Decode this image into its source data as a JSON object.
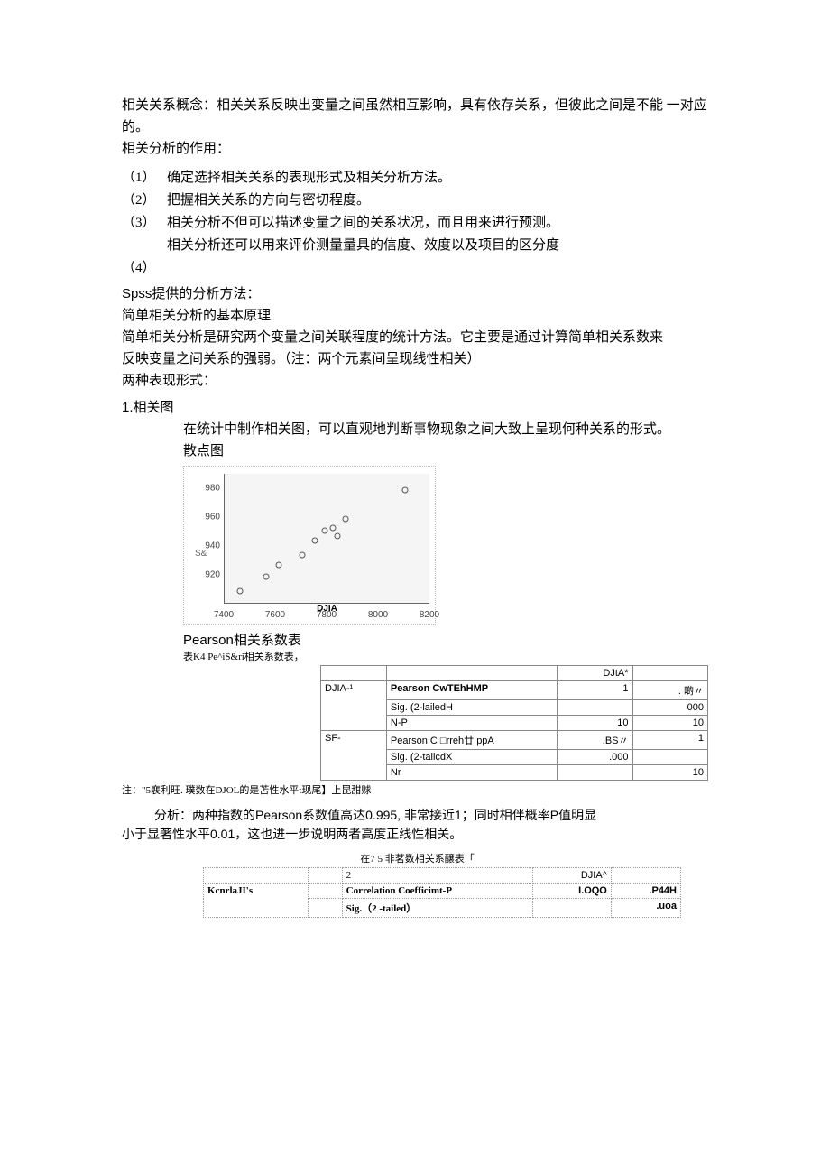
{
  "intro": {
    "line1": "相关关系概念：相关关系反映出变量之间虽然相互影响，具有依存关系，但彼此之间是不能 一对应的。",
    "line2": "相关分析的作用："
  },
  "list": {
    "items": [
      {
        "num": "（1）",
        "txt": "确定选择相关关系的表现形式及相关分析方法。"
      },
      {
        "num": "（2）",
        "txt": "把握相关关系的方向与密切程度。"
      },
      {
        "num": "（3）",
        "txt": "相关分析不但可以描述变量之间的关系状况，而且用来进行预测。"
      },
      {
        "num": "",
        "txt": "相关分析还可以用来评价测量量具的信度、效度以及项目的区分度"
      },
      {
        "num": "（4）",
        "txt": ""
      }
    ]
  },
  "body": {
    "spss": "Spss提供的分析方法：",
    "p1": "简单相关分析的基本原理",
    "p2": "简单相关分析是研究两个变量之间关联程度的统计方法。它主要是通过计算简单相关系数来",
    "p3": "反映变量之间关系的强弱。（注：两个元素间呈现线性相关）",
    "p4": "两种表现形式：",
    "h1": "1.相关图",
    "s1": "在统计中制作相关图，可以直观地判断事物现象之间大致上呈现何种关系的形式。",
    "s2": "散点图"
  },
  "chart_data": {
    "type": "scatter",
    "xlabel": "DJIA",
    "ylabel": "S&",
    "xlim": [
      7400,
      8200
    ],
    "ylim": [
      900,
      990
    ],
    "xticks": [
      7400,
      7600,
      7800,
      8000,
      8200
    ],
    "yticks": [
      920,
      940,
      960,
      980
    ],
    "points": [
      {
        "x": 7460,
        "y": 910
      },
      {
        "x": 7560,
        "y": 920
      },
      {
        "x": 7610,
        "y": 928
      },
      {
        "x": 7700,
        "y": 935
      },
      {
        "x": 7750,
        "y": 945
      },
      {
        "x": 7790,
        "y": 952
      },
      {
        "x": 7820,
        "y": 954
      },
      {
        "x": 7840,
        "y": 948
      },
      {
        "x": 7870,
        "y": 960
      },
      {
        "x": 8100,
        "y": 980
      }
    ]
  },
  "pearson": {
    "title": "Pearson相关系数表",
    "caption": "表K4 Pe^iS&ri相关系数表，",
    "col_djia": "DJtA*",
    "rows": [
      {
        "label": "DJIA-¹",
        "stat": "Pearson CwTEhHMP",
        "v1": "1",
        "v2": ". 啲〃"
      },
      {
        "label": "",
        "stat": "Sig. (2-lailedH",
        "v1": "",
        "v2": "000"
      },
      {
        "label": "",
        "stat": "N-P",
        "v1": "10",
        "v2": "10"
      },
      {
        "label": "SF-",
        "stat": "Pearson C □rreh廿 ppA",
        "v1": ".BS〃",
        "v2": "1"
      },
      {
        "label": "",
        "stat": "Sig. (2-tailcdX",
        "v1": ".000",
        "v2": ""
      },
      {
        "label": "",
        "stat": "Nr",
        "v1": "",
        "v2": "10"
      }
    ],
    "footnote": "注：\"5裵利旺. 璞数在DJOL的是苫性水平t现尾】上昆甜赇"
  },
  "analysis": {
    "line1": "分析：两种指数的Pearson系数值高达0.995, 非常接近1；同时相伴概率P值明显",
    "line2": "小于显著性水平0.01，这也进一步说明两者高度正线性相关。"
  },
  "table2": {
    "caption": "在7 5        非茗数相关系醸表「",
    "head2": "2",
    "head_djia": "DJIA^",
    "row_label": "KcnrlaJI's",
    "rows": [
      {
        "stat": "Correlation Coefficimt-P",
        "v1": "I.OQO",
        "v2": ".P44H"
      },
      {
        "stat": "Sig.（2 -tailed）",
        "v1": "",
        "v2": ".uoa"
      }
    ]
  }
}
